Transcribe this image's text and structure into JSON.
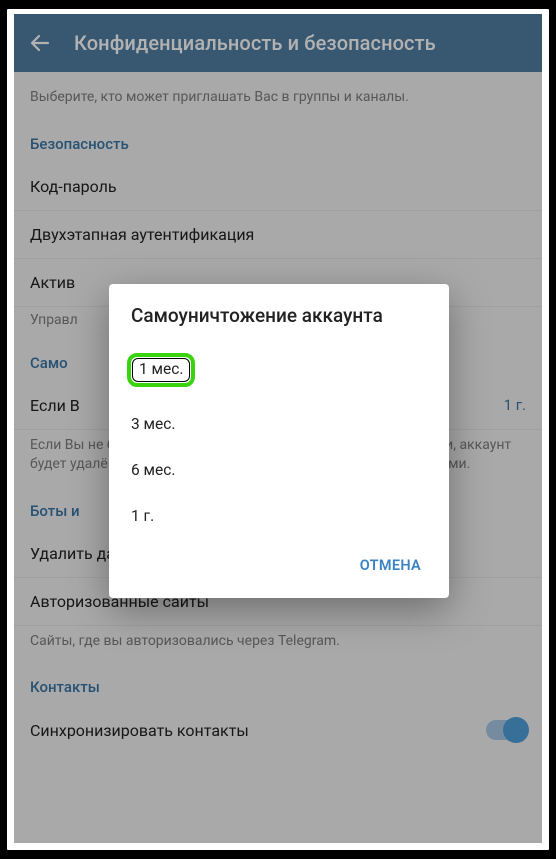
{
  "header": {
    "title": "Конфиденциальность и безопасность"
  },
  "intro": {
    "desc": "Выберите, кто может приглашать Вас в группы и каналы."
  },
  "sections": {
    "security": {
      "header": "Безопасность",
      "items": {
        "passcode": "Код-пароль",
        "twostep": "Двухэтапная аутентификация",
        "active_sessions_prefix": "Актив",
        "manage_prefix": "Управл"
      }
    },
    "selfdestruct": {
      "header_prefix": "Само",
      "if_prefix": "Если В",
      "if_value": "1 г.",
      "desc": "Если Вы не будете заходить в Telegram в течение этого времени, аккаунт будет удалён вместе со всеми сообщениями, медиа и контактами."
    },
    "bots": {
      "header_prefix": "Боты и",
      "payments": "Удалить данные о платежах и доставке",
      "authorized": "Авторизованные сайты",
      "desc": "Сайты, где вы авторизовались через Telegram."
    },
    "contacts": {
      "header": "Контакты",
      "sync": "Синхронизировать контакты"
    }
  },
  "dialog": {
    "title": "Самоуничтожение аккаунта",
    "options": [
      "1 мес.",
      "3 мес.",
      "6 мес.",
      "1 г."
    ],
    "selected_index": 0,
    "cancel": "ОТМЕНА"
  }
}
